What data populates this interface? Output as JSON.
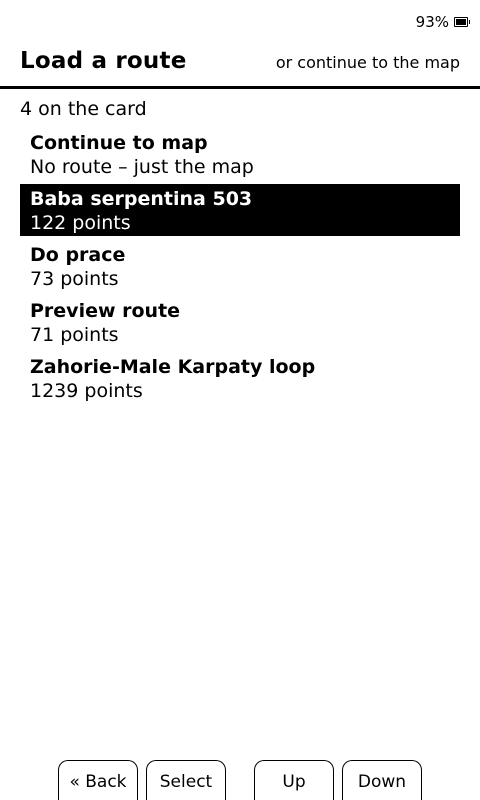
{
  "status": {
    "battery_percent": "93%",
    "battery_icon": "battery-charging-icon"
  },
  "header": {
    "title": "Load a route",
    "continue_link": "or continue to the map"
  },
  "count_label": "4 on the card",
  "routes": [
    {
      "name": "Continue to map",
      "detail": "No route – just the map",
      "selected": false
    },
    {
      "name": "Baba serpentina 503",
      "detail": "122 points",
      "selected": true
    },
    {
      "name": "Do prace",
      "detail": "73 points",
      "selected": false
    },
    {
      "name": "Preview route",
      "detail": "71 points",
      "selected": false
    },
    {
      "name": "Zahorie-Male Karpaty loop",
      "detail": "1239 points",
      "selected": false
    }
  ],
  "buttons": {
    "back": "« Back",
    "select": "Select",
    "up": "Up",
    "down": "Down"
  }
}
